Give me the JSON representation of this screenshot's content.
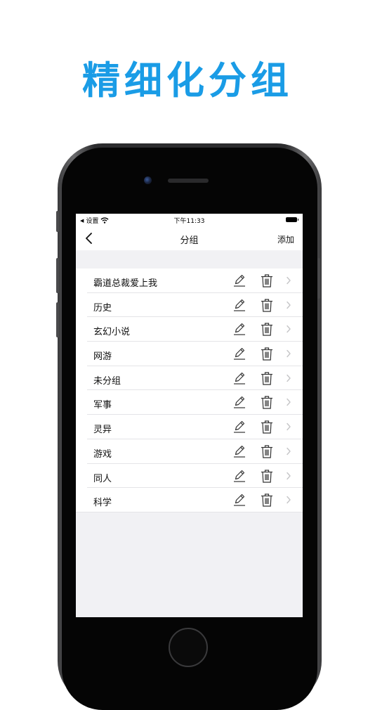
{
  "promo": {
    "headline": "精细化分组"
  },
  "status_bar": {
    "back_app": "设置",
    "time": "下午11:33"
  },
  "nav": {
    "title": "分组",
    "add_label": "添加"
  },
  "groups": [
    {
      "label": "霸道总裁爱上我"
    },
    {
      "label": "历史"
    },
    {
      "label": "玄幻小说"
    },
    {
      "label": "网游"
    },
    {
      "label": "未分组"
    },
    {
      "label": "军事"
    },
    {
      "label": "灵异"
    },
    {
      "label": "游戏"
    },
    {
      "label": "同人"
    },
    {
      "label": "科学"
    }
  ],
  "colors": {
    "accent": "#1a9ce6",
    "icon": "#333333",
    "chevron": "#c5c5c7"
  }
}
